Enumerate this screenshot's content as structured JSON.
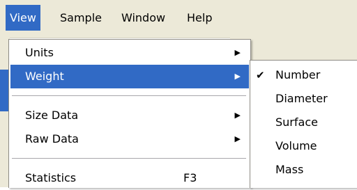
{
  "menubar": {
    "items": [
      {
        "label": "View",
        "mnemonic": "V",
        "active": true
      },
      {
        "label": "Sample",
        "mnemonic": "S",
        "active": false
      },
      {
        "label": "Window",
        "mnemonic": "W",
        "active": false
      },
      {
        "label": "Help",
        "mnemonic": "H",
        "active": false
      }
    ]
  },
  "view_menu": {
    "items": [
      {
        "label": "Units",
        "has_submenu": true
      },
      {
        "label": "Weight",
        "has_submenu": true,
        "highlighted": true
      },
      {
        "label": "Size Data",
        "has_submenu": true
      },
      {
        "label": "Raw Data",
        "has_submenu": true
      },
      {
        "label": "Statistics",
        "shortcut": "F3"
      }
    ]
  },
  "weight_submenu": {
    "items": [
      {
        "label": "Number",
        "checked": true
      },
      {
        "label": "Diameter",
        "checked": false
      },
      {
        "label": "Surface",
        "checked": false
      },
      {
        "label": "Volume",
        "checked": false
      },
      {
        "label": "Mass",
        "checked": false
      }
    ]
  },
  "colors": {
    "highlight": "#316ac5",
    "menubar_bg": "#ece9d8",
    "menu_bg": "#ffffff"
  },
  "icons": {
    "submenu_arrow": "arrow-right-icon",
    "check": "checkmark-icon"
  }
}
